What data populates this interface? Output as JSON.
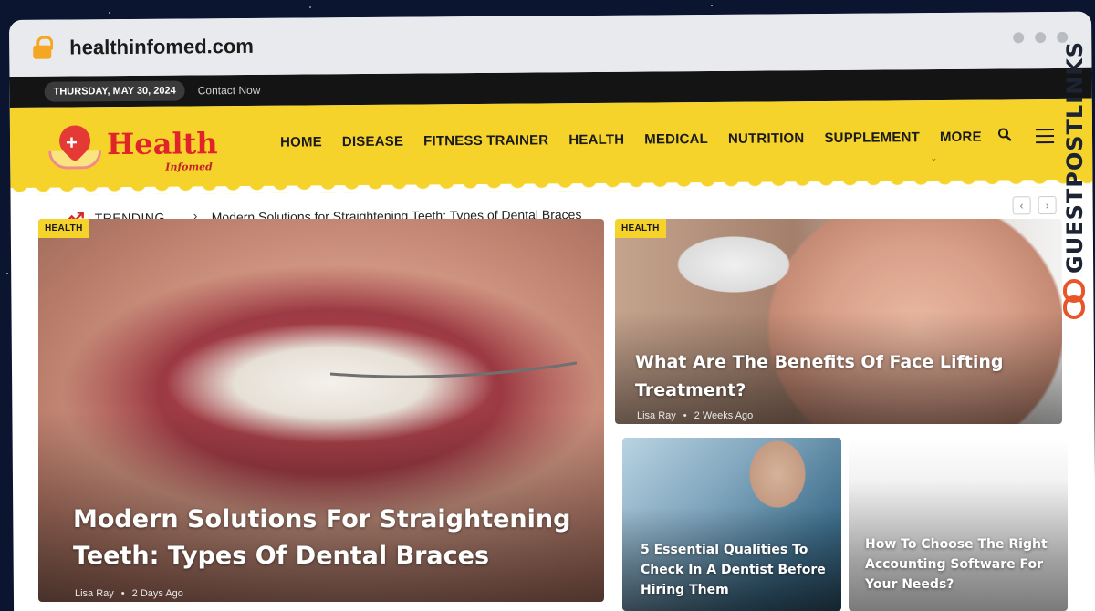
{
  "browser": {
    "url": "healthinfomed.com"
  },
  "topbar": {
    "date": "THURSDAY, MAY 30, 2024",
    "contact": "Contact Now"
  },
  "logo": {
    "title": "Health",
    "subtitle": "Infomed"
  },
  "nav": {
    "items": [
      "HOME",
      "DISEASE",
      "FITNESS TRAINER",
      "HEALTH",
      "MEDICAL",
      "NUTRITION",
      "SUPPLEMENT",
      "MORE"
    ]
  },
  "trending": {
    "label": "TRENDING",
    "headline": "Modern Solutions for Straightening Teeth: Types of Dental Braces"
  },
  "cards": [
    {
      "badge": "HEALTH",
      "title": "Modern Solutions For Straightening Teeth: Types Of Dental Braces",
      "author": "Lisa Ray",
      "time": "2 Days Ago"
    },
    {
      "badge": "HEALTH",
      "title": "What Are The Benefits Of Face Lifting Treatment?",
      "author": "Lisa Ray",
      "time": "2 Weeks Ago"
    },
    {
      "title": "5 Essential Qualities To Check In A Dentist Before Hiring Them"
    },
    {
      "title": "How To Choose The Right Accounting Software For Your Needs?"
    }
  ],
  "watermark": {
    "text": "GUESTPOSTLINKS"
  },
  "colors": {
    "accent": "#f6d32b",
    "topbar": "#141414",
    "logo_red": "#e0242a",
    "lock": "#f5a623"
  }
}
